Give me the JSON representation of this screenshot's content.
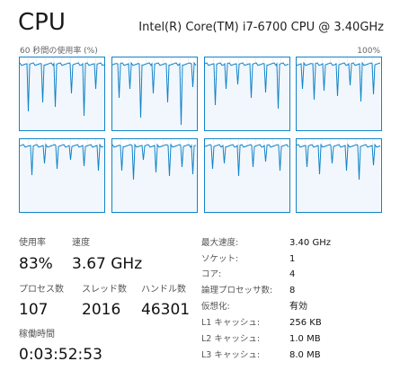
{
  "header": {
    "title": "CPU",
    "model": "Intel(R) Core(TM) i7-6700 CPU @ 3.40GHz"
  },
  "graph": {
    "axis_left": "60 秒間の使用率 (%)",
    "axis_right": "100%",
    "accent_color": "#1183c9",
    "grid_color": "#d9eaf7",
    "core_count": 8
  },
  "stats": {
    "utilization": {
      "label": "使用率",
      "value": "83%"
    },
    "speed": {
      "label": "速度",
      "value": "3.67 GHz"
    },
    "processes": {
      "label": "プロセス数",
      "value": "107"
    },
    "threads": {
      "label": "スレッド数",
      "value": "2016"
    },
    "handles": {
      "label": "ハンドル数",
      "value": "46301"
    },
    "uptime": {
      "label": "稼働時間",
      "value": "0:03:52:53"
    }
  },
  "specs": [
    {
      "key": "最大速度:",
      "value": "3.40 GHz"
    },
    {
      "key": "ソケット:",
      "value": "1"
    },
    {
      "key": "コア:",
      "value": "4"
    },
    {
      "key": "論理プロセッサ数:",
      "value": "8"
    },
    {
      "key": "仮想化:",
      "value": "有効"
    },
    {
      "key": "L1 キャッシュ:",
      "value": "256 KB"
    },
    {
      "key": "L2 キャッシュ:",
      "value": "1.0 MB"
    },
    {
      "key": "L3 キャッシュ:",
      "value": "8.0 MB"
    }
  ]
}
